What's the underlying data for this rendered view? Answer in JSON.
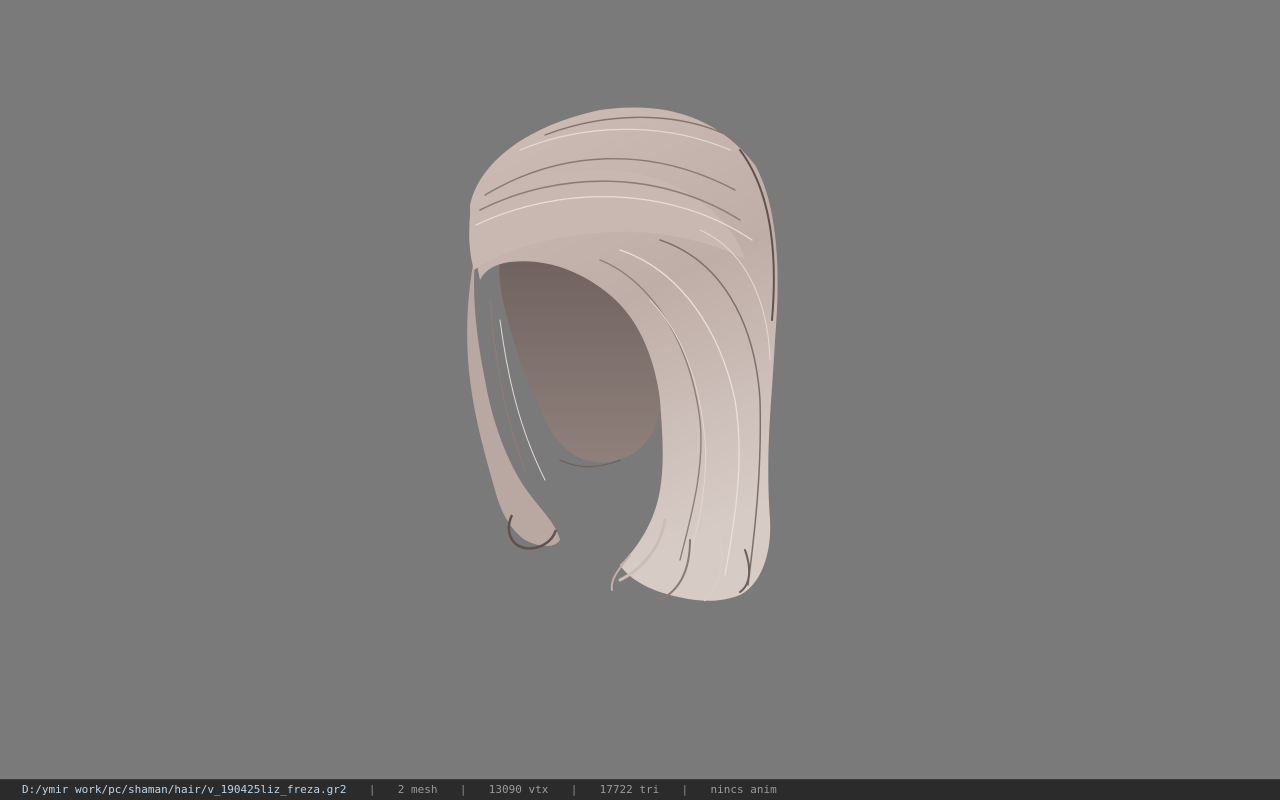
{
  "viewer": {
    "background_color": "#7a7a7a",
    "model": "hair-mesh",
    "hair_base_color": "#c7b7b0",
    "hair_shadow_color": "#7f6f6a",
    "hair_highlight_color": "#eadfd9"
  },
  "status_bar": {
    "file_path": "D:/ymir work/pc/shaman/hair/v_190425liz_freza.gr2",
    "separator": "|",
    "mesh_count": "2 mesh",
    "vertex_count": "13090 vtx",
    "triangle_count": "17722 tri",
    "anim_status": "nincs anim"
  }
}
